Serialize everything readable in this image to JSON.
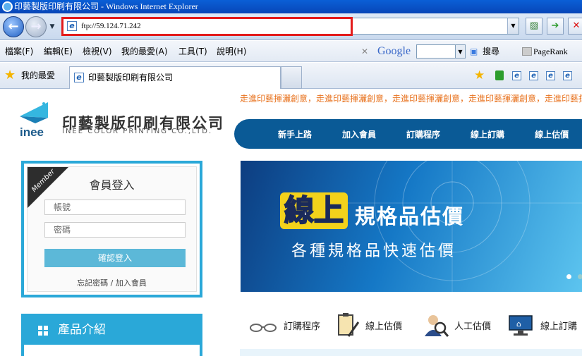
{
  "window": {
    "title": "印藝製版印刷有限公司 - Windows Internet Explorer"
  },
  "address": {
    "url": "ftp://59.124.71.242"
  },
  "menu": [
    "檔案(F)",
    "編輯(E)",
    "檢視(V)",
    "我的最愛(A)",
    "工具(T)",
    "說明(H)"
  ],
  "google": {
    "label": "Google",
    "search": "搜尋",
    "pagerank": "PageRank"
  },
  "favorites": {
    "label": "我的最愛",
    "tab_title": "印藝製版印刷有限公司"
  },
  "site": {
    "ticker": "走進印藝揮灑創意，走進印藝揮灑創意，走進印藝揮灑創意，走進印藝揮灑創意，走進印藝揮灑創意",
    "logo_cn": "印藝製版印刷有限公司",
    "logo_en": "INEE COLOR PRINTING CO.,LTD.",
    "logo_word": "inee",
    "nav": [
      "新手上路",
      "加入會員",
      "訂購程序",
      "線上訂購",
      "線上估價"
    ],
    "member": {
      "ribbon": "Member",
      "title": "會員登入",
      "account_placeholder": "帳號",
      "password_placeholder": "密碼",
      "login_button": "確認登入",
      "forgot": "忘記密碼 / 加入會員"
    },
    "products_title": "產品介紹",
    "banner": {
      "highlight": "線上",
      "headline": "規格品估價",
      "subline": "各種規格品快速估價"
    },
    "quicklinks": [
      "訂購程序",
      "線上估價",
      "人工估價",
      "線上訂購"
    ]
  }
}
